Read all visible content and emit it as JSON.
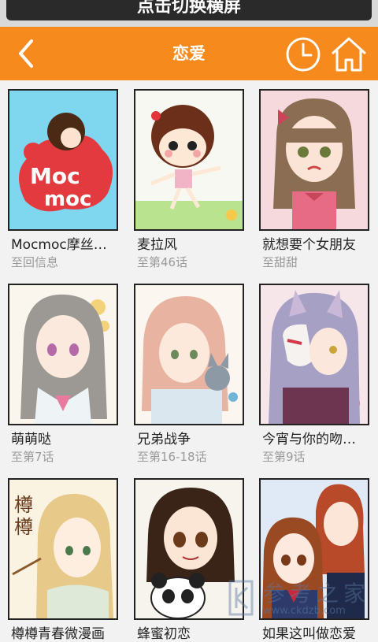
{
  "status_toast": "点击切换横屏",
  "header": {
    "title": "恋爱",
    "accent": "#f68a1d"
  },
  "icons": {
    "back": "chevron-left-icon",
    "history": "clock-icon",
    "home": "home-icon"
  },
  "comics": [
    {
      "title": "Mocmoc摩丝…",
      "subtitle": "至回信息"
    },
    {
      "title": "麦拉风",
      "subtitle": "至第46话"
    },
    {
      "title": "就想要个女朋友",
      "subtitle": "至甜甜"
    },
    {
      "title": "萌萌哒",
      "subtitle": "至第7话"
    },
    {
      "title": "兄弟战争",
      "subtitle": "至第16-18话"
    },
    {
      "title": "今宵与你的吻…",
      "subtitle": "至第9话"
    },
    {
      "title": "樽樽青春微漫画",
      "subtitle": ""
    },
    {
      "title": "蜂蜜初恋",
      "subtitle": ""
    },
    {
      "title": "如果这叫做恋爱",
      "subtitle": ""
    }
  ],
  "watermark": {
    "text": "参考之家",
    "url": "www.ckdzb.com"
  }
}
